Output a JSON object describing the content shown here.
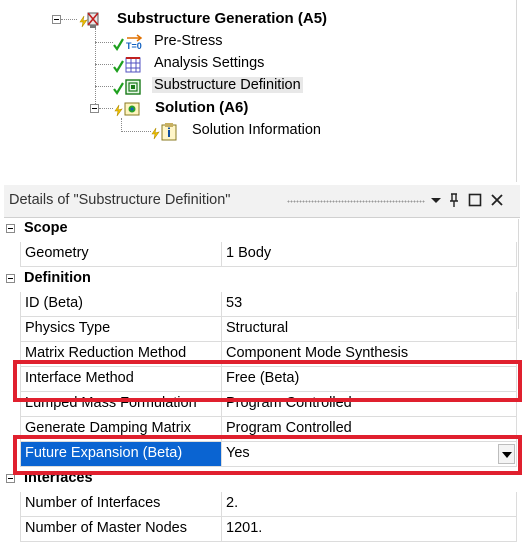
{
  "tree": {
    "nodes": [
      {
        "id": "substructure-generation",
        "label": "Substructure Generation (A5)",
        "bold": true
      },
      {
        "id": "pre-stress",
        "label": "Pre-Stress",
        "icon_text": "T=0"
      },
      {
        "id": "analysis-settings",
        "label": "Analysis Settings"
      },
      {
        "id": "substructure-definition",
        "label": "Substructure Definition",
        "selected": true
      },
      {
        "id": "solution",
        "label": "Solution (A6)",
        "bold": true
      },
      {
        "id": "solution-information",
        "label": "Solution Information"
      }
    ]
  },
  "details": {
    "title": "Details of \"Substructure Definition\"",
    "buttons": {
      "dropdown": "▾",
      "pin": "│",
      "maximize": "□",
      "close": "✕"
    },
    "sections": [
      {
        "label": "Scope",
        "rows": [
          {
            "name": "Geometry",
            "value": "1 Body"
          }
        ]
      },
      {
        "label": "Definition",
        "rows": [
          {
            "name": "ID (Beta)",
            "value": "53"
          },
          {
            "name": "Physics Type",
            "value": "Structural"
          },
          {
            "name": "Matrix Reduction Method",
            "value": "Component Mode Synthesis"
          },
          {
            "name": "Interface Method",
            "value": "Free (Beta)"
          },
          {
            "name": "Lumped Mass Formulation",
            "value": "Program Controlled"
          },
          {
            "name": "Generate Damping Matrix",
            "value": "Program Controlled"
          },
          {
            "name": "Future Expansion (Beta)",
            "value": "Yes",
            "selected": true
          }
        ]
      },
      {
        "label": "Interfaces",
        "rows": [
          {
            "name": "Number of Interfaces",
            "value": "2."
          },
          {
            "name": "Number of Master Nodes",
            "value": "1201."
          }
        ]
      }
    ]
  },
  "colors": {
    "highlight": "#e0202e",
    "selection": "#0a64d2",
    "check": "#1fa01f",
    "lightning": "#f2c200"
  }
}
